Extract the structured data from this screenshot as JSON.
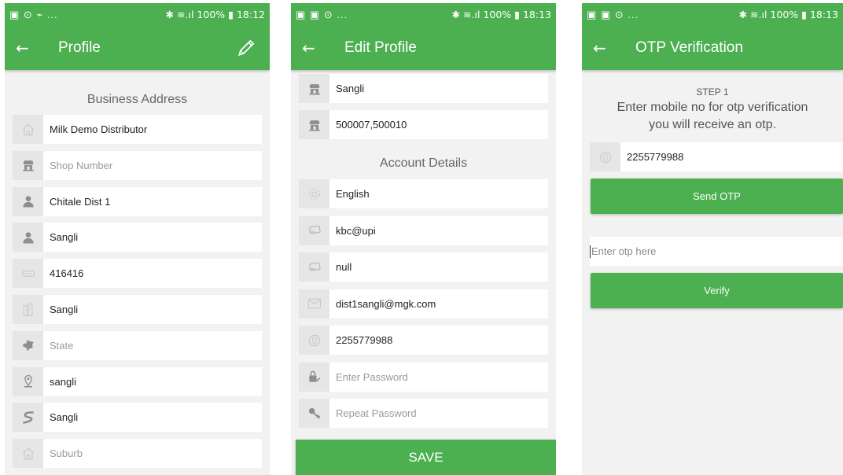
{
  "status_bars": [
    {
      "left": "▣ ⊙ ⌁ ...",
      "right": "✱ ≋.ıl 100% ▮ 18:12"
    },
    {
      "left": "▣ ▣ ⊙ ...",
      "right": "✱ ≋.ıl 100% ▮ 18:13"
    },
    {
      "left": "▣ ▣ ⊙ ...",
      "right": "✱ ≋.ıl 100% ▮ 18:13"
    }
  ],
  "profile": {
    "back": "←",
    "title": "Profile",
    "section": "Business Address",
    "fields": [
      {
        "icon": "home-icon",
        "value": "Milk  Demo Distributor",
        "placeholder": false
      },
      {
        "icon": "shop-icon",
        "value": "Shop Number",
        "placeholder": true
      },
      {
        "icon": "person-icon",
        "value": "Chitale Dist 1",
        "placeholder": false
      },
      {
        "icon": "person-icon",
        "value": "Sangli",
        "placeholder": false
      },
      {
        "icon": "pin-code-icon",
        "value": "416416",
        "placeholder": false
      },
      {
        "icon": "city-icon",
        "value": "Sangli",
        "placeholder": false
      },
      {
        "icon": "state-map-icon",
        "value": "State",
        "placeholder": true
      },
      {
        "icon": "location-pin-icon",
        "value": "sangli",
        "placeholder": false
      },
      {
        "icon": "road-icon",
        "value": "Sangli",
        "placeholder": false
      },
      {
        "icon": "home-icon",
        "value": "Suburb",
        "placeholder": true
      }
    ]
  },
  "edit_profile": {
    "back": "←",
    "title": "Edit Profile",
    "fields_top": [
      {
        "icon": "shop-icon",
        "value": "Sangli",
        "placeholder": false
      },
      {
        "icon": "shop-icon",
        "value": "500007,500010",
        "placeholder": false
      }
    ],
    "section": "Account Details",
    "fields_account": [
      {
        "icon": "gear-icon",
        "value": "English",
        "placeholder": false
      },
      {
        "icon": "card-icon",
        "value": "kbc@upi",
        "placeholder": false
      },
      {
        "icon": "card-icon",
        "value": "null",
        "placeholder": false
      },
      {
        "icon": "email-icon",
        "value": "dist1sangli@mgk.com",
        "placeholder": false
      },
      {
        "icon": "phone-icon",
        "value": "2255779988",
        "placeholder": false
      },
      {
        "icon": "lock-icon",
        "value": "Enter Password",
        "placeholder": true
      },
      {
        "icon": "key-icon",
        "value": "Repeat Password",
        "placeholder": true
      }
    ],
    "save_label": "SAVE"
  },
  "otp": {
    "back": "←",
    "title": "OTP Verification",
    "step": "STEP 1",
    "instruction_1": "Enter mobile no for otp verification",
    "instruction_2": "you will receive an otp.",
    "mobile_value": "2255779988",
    "send_label": "Send OTP",
    "otp_placeholder": "Enter otp here",
    "verify_label": "Verify"
  },
  "colors": {
    "primary": "#4caf50",
    "background": "#f2f2f2",
    "icon_bg": "#e6e6e6"
  }
}
